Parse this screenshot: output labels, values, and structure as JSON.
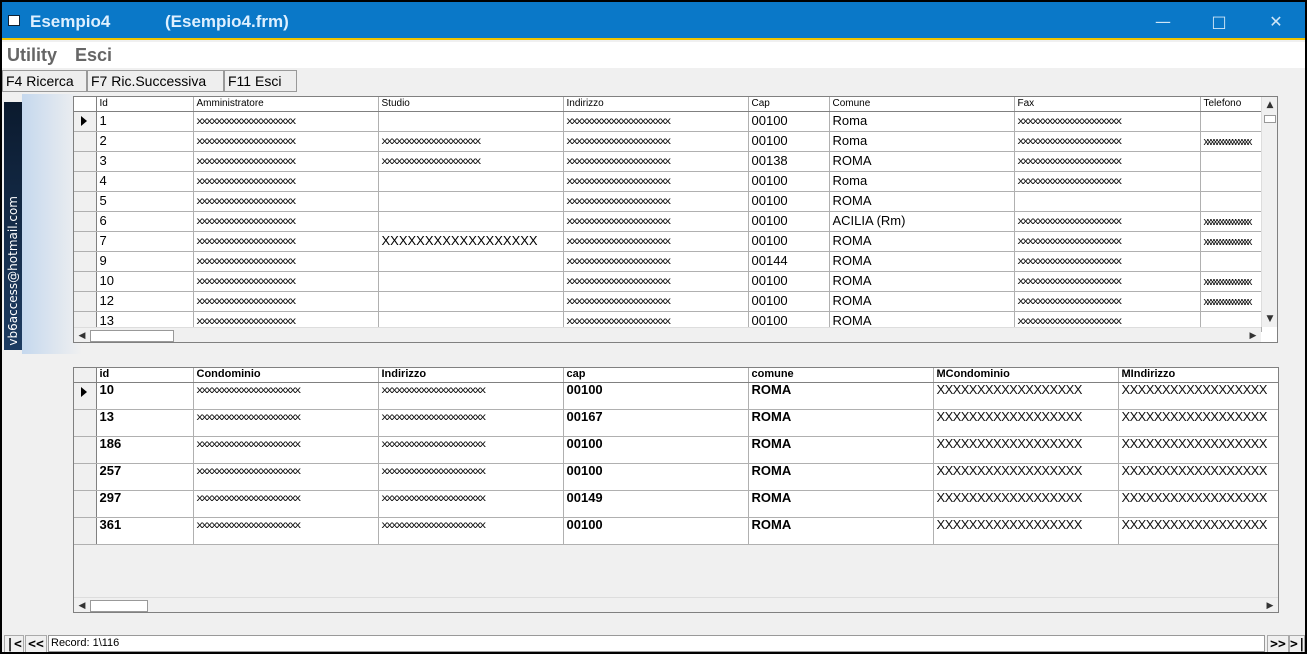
{
  "window": {
    "title": "Esempio4",
    "subtitle": "(Esempio4.frm)"
  },
  "menu": [
    "Utility",
    "Esci"
  ],
  "toolbar": [
    "F4 Ricerca",
    "F7 Ric.Successiva",
    "F11 Esci"
  ],
  "sidebar_text": "vb6access@hotmail.com",
  "grid1": {
    "columns": [
      "Id",
      "Amministratore",
      "Studio",
      "Indirizzo",
      "Cap",
      "Comune",
      "Fax",
      "Telefono"
    ],
    "rows": [
      [
        "1",
        "xxxxxxxxxxxxxxxxxxxx",
        "",
        "xxxxxxxxxxxxxxxxxxxxx",
        "00100",
        "Roma",
        "xxxxxxxxxxxxxxxxxxxxx",
        ""
      ],
      [
        "2",
        "xxxxxxxxxxxxxxxxxxxx",
        "xxxxxxxxxxxxxxxxxxxx",
        "xxxxxxxxxxxxxxxxxxxxx",
        "00100",
        "Roma",
        "xxxxxxxxxxxxxxxxxxxxx",
        "xxxxxxxxxxxxxxx"
      ],
      [
        "3",
        "xxxxxxxxxxxxxxxxxxxx",
        "xxxxxxxxxxxxxxxxxxxx",
        "xxxxxxxxxxxxxxxxxxxxx",
        "00138",
        "ROMA",
        "xxxxxxxxxxxxxxxxxxxxx",
        ""
      ],
      [
        "4",
        "xxxxxxxxxxxxxxxxxxxx",
        "",
        "xxxxxxxxxxxxxxxxxxxxx",
        "00100",
        "Roma",
        "xxxxxxxxxxxxxxxxxxxxx",
        ""
      ],
      [
        "5",
        "xxxxxxxxxxxxxxxxxxxx",
        "",
        "xxxxxxxxxxxxxxxxxxxxx",
        "00100",
        "ROMA",
        "",
        ""
      ],
      [
        "6",
        "xxxxxxxxxxxxxxxxxxxx",
        "",
        "xxxxxxxxxxxxxxxxxxxxx",
        "00100",
        "ACILIA (Rm)",
        "xxxxxxxxxxxxxxxxxxxxx",
        "xxxxxxxxxxxxxxx"
      ],
      [
        "7",
        "xxxxxxxxxxxxxxxxxxxx",
        "XXXXXXXXXXXXXXXXXX",
        "xxxxxxxxxxxxxxxxxxxxx",
        "00100",
        "ROMA",
        "xxxxxxxxxxxxxxxxxxxxx",
        "xxxxxxxxxxxxxxx"
      ],
      [
        "9",
        "xxxxxxxxxxxxxxxxxxxx",
        "",
        "xxxxxxxxxxxxxxxxxxxxx",
        "00144",
        "ROMA",
        "xxxxxxxxxxxxxxxxxxxxx",
        ""
      ],
      [
        "10",
        "xxxxxxxxxxxxxxxxxxxx",
        "",
        "xxxxxxxxxxxxxxxxxxxxx",
        "00100",
        "ROMA",
        "xxxxxxxxxxxxxxxxxxxxx",
        "xxxxxxxxxxxxxxx"
      ],
      [
        "12",
        "xxxxxxxxxxxxxxxxxxxx",
        "",
        "xxxxxxxxxxxxxxxxxxxxx",
        "00100",
        "ROMA",
        "xxxxxxxxxxxxxxxxxxxxx",
        "xxxxxxxxxxxxxxx"
      ],
      [
        "13",
        "xxxxxxxxxxxxxxxxxxxx",
        "",
        "xxxxxxxxxxxxxxxxxxxxx",
        "00100",
        "ROMA",
        "xxxxxxxxxxxxxxxxxxxxx",
        ""
      ]
    ]
  },
  "grid2": {
    "columns": [
      "id",
      "Condominio",
      "Indirizzo",
      "cap",
      "comune",
      "MCondominio",
      "MIndirizzo"
    ],
    "rows": [
      [
        "10",
        "xxxxxxxxxxxxxxxxxxxxx",
        "xxxxxxxxxxxxxxxxxxxxx",
        "00100",
        "ROMA",
        "XXXXXXXXXXXXXXXXXX",
        "XXXXXXXXXXXXXXXXXX"
      ],
      [
        "13",
        "xxxxxxxxxxxxxxxxxxxxx",
        "xxxxxxxxxxxxxxxxxxxxx",
        "00167",
        "ROMA",
        "XXXXXXXXXXXXXXXXXX",
        "XXXXXXXXXXXXXXXXXX"
      ],
      [
        "186",
        "xxxxxxxxxxxxxxxxxxxxx",
        "xxxxxxxxxxxxxxxxxxxxx",
        "00100",
        "ROMA",
        "XXXXXXXXXXXXXXXXXX",
        "XXXXXXXXXXXXXXXXXX"
      ],
      [
        "257",
        "xxxxxxxxxxxxxxxxxxxxx",
        "xxxxxxxxxxxxxxxxxxxxx",
        "00100",
        "ROMA",
        "XXXXXXXXXXXXXXXXXX",
        "XXXXXXXXXXXXXXXXXX"
      ],
      [
        "297",
        "xxxxxxxxxxxxxxxxxxxxx",
        "xxxxxxxxxxxxxxxxxxxxx",
        "00149",
        "ROMA",
        "XXXXXXXXXXXXXXXXXX",
        "XXXXXXXXXXXXXXXXXX"
      ],
      [
        "361",
        "xxxxxxxxxxxxxxxxxxxxx",
        "xxxxxxxxxxxxxxxxxxxxx",
        "00100",
        "ROMA",
        "XXXXXXXXXXXXXXXXXX",
        "XXXXXXXXXXXXXXXXXX"
      ]
    ]
  },
  "navigator": {
    "first": "|<",
    "prev": "<<",
    "record": "Record: 1\\116",
    "next": ">>",
    "last": ">|"
  }
}
